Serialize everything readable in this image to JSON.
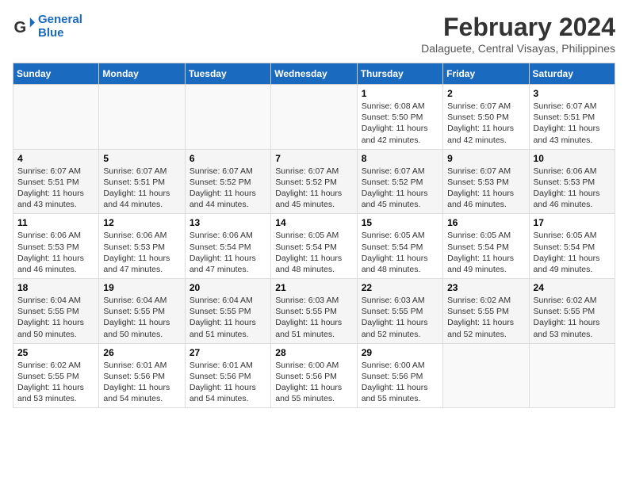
{
  "logo": {
    "line1": "General",
    "line2": "Blue"
  },
  "title": {
    "month_year": "February 2024",
    "location": "Dalaguete, Central Visayas, Philippines"
  },
  "headers": [
    "Sunday",
    "Monday",
    "Tuesday",
    "Wednesday",
    "Thursday",
    "Friday",
    "Saturday"
  ],
  "weeks": [
    [
      {
        "day": "",
        "info": ""
      },
      {
        "day": "",
        "info": ""
      },
      {
        "day": "",
        "info": ""
      },
      {
        "day": "",
        "info": ""
      },
      {
        "day": "1",
        "info": "Sunrise: 6:08 AM\nSunset: 5:50 PM\nDaylight: 11 hours\nand 42 minutes."
      },
      {
        "day": "2",
        "info": "Sunrise: 6:07 AM\nSunset: 5:50 PM\nDaylight: 11 hours\nand 42 minutes."
      },
      {
        "day": "3",
        "info": "Sunrise: 6:07 AM\nSunset: 5:51 PM\nDaylight: 11 hours\nand 43 minutes."
      }
    ],
    [
      {
        "day": "4",
        "info": "Sunrise: 6:07 AM\nSunset: 5:51 PM\nDaylight: 11 hours\nand 43 minutes."
      },
      {
        "day": "5",
        "info": "Sunrise: 6:07 AM\nSunset: 5:51 PM\nDaylight: 11 hours\nand 44 minutes."
      },
      {
        "day": "6",
        "info": "Sunrise: 6:07 AM\nSunset: 5:52 PM\nDaylight: 11 hours\nand 44 minutes."
      },
      {
        "day": "7",
        "info": "Sunrise: 6:07 AM\nSunset: 5:52 PM\nDaylight: 11 hours\nand 45 minutes."
      },
      {
        "day": "8",
        "info": "Sunrise: 6:07 AM\nSunset: 5:52 PM\nDaylight: 11 hours\nand 45 minutes."
      },
      {
        "day": "9",
        "info": "Sunrise: 6:07 AM\nSunset: 5:53 PM\nDaylight: 11 hours\nand 46 minutes."
      },
      {
        "day": "10",
        "info": "Sunrise: 6:06 AM\nSunset: 5:53 PM\nDaylight: 11 hours\nand 46 minutes."
      }
    ],
    [
      {
        "day": "11",
        "info": "Sunrise: 6:06 AM\nSunset: 5:53 PM\nDaylight: 11 hours\nand 46 minutes."
      },
      {
        "day": "12",
        "info": "Sunrise: 6:06 AM\nSunset: 5:53 PM\nDaylight: 11 hours\nand 47 minutes."
      },
      {
        "day": "13",
        "info": "Sunrise: 6:06 AM\nSunset: 5:54 PM\nDaylight: 11 hours\nand 47 minutes."
      },
      {
        "day": "14",
        "info": "Sunrise: 6:05 AM\nSunset: 5:54 PM\nDaylight: 11 hours\nand 48 minutes."
      },
      {
        "day": "15",
        "info": "Sunrise: 6:05 AM\nSunset: 5:54 PM\nDaylight: 11 hours\nand 48 minutes."
      },
      {
        "day": "16",
        "info": "Sunrise: 6:05 AM\nSunset: 5:54 PM\nDaylight: 11 hours\nand 49 minutes."
      },
      {
        "day": "17",
        "info": "Sunrise: 6:05 AM\nSunset: 5:54 PM\nDaylight: 11 hours\nand 49 minutes."
      }
    ],
    [
      {
        "day": "18",
        "info": "Sunrise: 6:04 AM\nSunset: 5:55 PM\nDaylight: 11 hours\nand 50 minutes."
      },
      {
        "day": "19",
        "info": "Sunrise: 6:04 AM\nSunset: 5:55 PM\nDaylight: 11 hours\nand 50 minutes."
      },
      {
        "day": "20",
        "info": "Sunrise: 6:04 AM\nSunset: 5:55 PM\nDaylight: 11 hours\nand 51 minutes."
      },
      {
        "day": "21",
        "info": "Sunrise: 6:03 AM\nSunset: 5:55 PM\nDaylight: 11 hours\nand 51 minutes."
      },
      {
        "day": "22",
        "info": "Sunrise: 6:03 AM\nSunset: 5:55 PM\nDaylight: 11 hours\nand 52 minutes."
      },
      {
        "day": "23",
        "info": "Sunrise: 6:02 AM\nSunset: 5:55 PM\nDaylight: 11 hours\nand 52 minutes."
      },
      {
        "day": "24",
        "info": "Sunrise: 6:02 AM\nSunset: 5:55 PM\nDaylight: 11 hours\nand 53 minutes."
      }
    ],
    [
      {
        "day": "25",
        "info": "Sunrise: 6:02 AM\nSunset: 5:55 PM\nDaylight: 11 hours\nand 53 minutes."
      },
      {
        "day": "26",
        "info": "Sunrise: 6:01 AM\nSunset: 5:56 PM\nDaylight: 11 hours\nand 54 minutes."
      },
      {
        "day": "27",
        "info": "Sunrise: 6:01 AM\nSunset: 5:56 PM\nDaylight: 11 hours\nand 54 minutes."
      },
      {
        "day": "28",
        "info": "Sunrise: 6:00 AM\nSunset: 5:56 PM\nDaylight: 11 hours\nand 55 minutes."
      },
      {
        "day": "29",
        "info": "Sunrise: 6:00 AM\nSunset: 5:56 PM\nDaylight: 11 hours\nand 55 minutes."
      },
      {
        "day": "",
        "info": ""
      },
      {
        "day": "",
        "info": ""
      }
    ]
  ]
}
